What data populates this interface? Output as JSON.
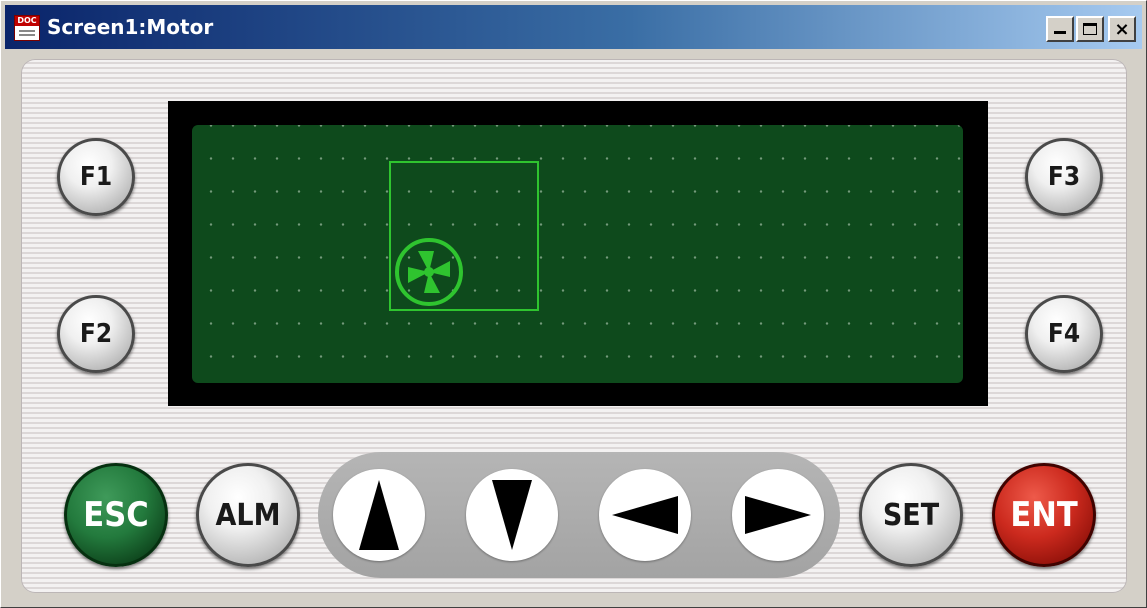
{
  "window": {
    "title": "Screen1:Motor",
    "icon": "document-icon",
    "controls": {
      "minimize": "minimize-icon",
      "maximize": "maximize-icon",
      "close": "×"
    }
  },
  "display": {
    "background_color": "#0e4a1c",
    "object_color": "#2fc42f",
    "objects": [
      {
        "type": "motor-box",
        "icon": "fan-icon"
      }
    ]
  },
  "keys": {
    "f1": "F1",
    "f2": "F2",
    "f3": "F3",
    "f4": "F4",
    "esc": "ESC",
    "alm": "ALM",
    "set": "SET",
    "ent": "ENT",
    "up": "up-arrow-icon",
    "down": "down-arrow-icon",
    "left": "left-arrow-icon",
    "right": "right-arrow-icon"
  },
  "colors": {
    "esc_button": "#237a3d",
    "ent_button": "#cc2a1e",
    "title_bar_start": "#0a246a",
    "title_bar_end": "#a6caf0"
  }
}
